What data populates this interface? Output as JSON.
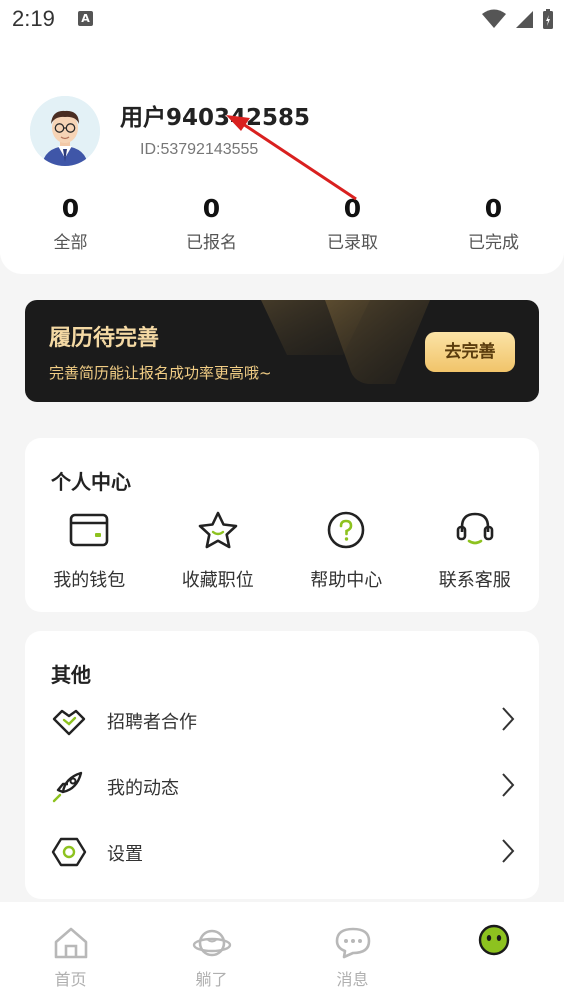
{
  "status": {
    "time": "2:19",
    "notification_badge": "A"
  },
  "profile": {
    "username": "用户940342585",
    "user_id": "ID:53792143555",
    "stats": [
      {
        "value": "0",
        "label": "全部"
      },
      {
        "value": "0",
        "label": "已报名"
      },
      {
        "value": "0",
        "label": "已录取"
      },
      {
        "value": "0",
        "label": "已完成"
      }
    ]
  },
  "banner": {
    "title": "履历待完善",
    "subtitle": "完善简历能让报名成功率更高哦~",
    "button": "去完善"
  },
  "personal_center": {
    "title": "个人中心",
    "items": [
      {
        "label": "我的钱包",
        "icon": "wallet-icon"
      },
      {
        "label": "收藏职位",
        "icon": "star-icon"
      },
      {
        "label": "帮助中心",
        "icon": "help-icon"
      },
      {
        "label": "联系客服",
        "icon": "headset-icon"
      }
    ]
  },
  "other": {
    "title": "其他",
    "items": [
      {
        "label": "招聘者合作",
        "icon": "handshake-icon"
      },
      {
        "label": "我的动态",
        "icon": "rocket-icon"
      },
      {
        "label": "设置",
        "icon": "settings-icon"
      }
    ]
  },
  "nav": {
    "items": [
      {
        "label": "首页",
        "icon": "home-icon"
      },
      {
        "label": "躺了",
        "icon": "planet-icon"
      },
      {
        "label": "消息",
        "icon": "message-icon"
      },
      {
        "label": "",
        "icon": "smiley-icon"
      }
    ]
  },
  "colors": {
    "accent_green": "#8dc21f",
    "banner_bg": "#1b1b1b",
    "banner_gold": "#f4d9a4",
    "annotation_red": "#d9201f"
  }
}
